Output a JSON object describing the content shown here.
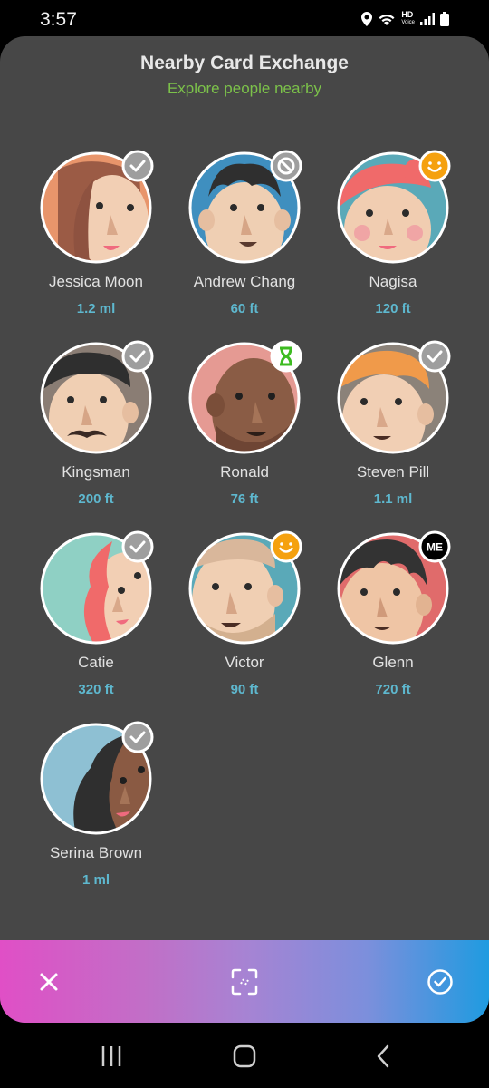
{
  "status_bar": {
    "time": "3:57",
    "hd_label": "HD",
    "voice_label": "Voice"
  },
  "header": {
    "title": "Nearby Card Exchange",
    "subtitle": "Explore people nearby"
  },
  "people": [
    {
      "name": "Jessica Moon",
      "distance": "1.2 ml",
      "badge": "check-icon"
    },
    {
      "name": "Andrew Chang",
      "distance": "60 ft",
      "badge": "blocked-icon"
    },
    {
      "name": "Nagisa",
      "distance": "120 ft",
      "badge": "smile-icon"
    },
    {
      "name": "Kingsman",
      "distance": "200 ft",
      "badge": "check-icon"
    },
    {
      "name": "Ronald",
      "distance": "76 ft",
      "badge": "hourglass-icon"
    },
    {
      "name": "Steven Pill",
      "distance": "1.1 ml",
      "badge": "check-icon"
    },
    {
      "name": "Catie",
      "distance": "320 ft",
      "badge": "check-icon"
    },
    {
      "name": "Victor",
      "distance": "90 ft",
      "badge": "smile-icon"
    },
    {
      "name": "Glenn",
      "distance": "720 ft",
      "badge": "me-badge",
      "badge_text": "ME"
    },
    {
      "name": "Serina Brown",
      "distance": "1 ml",
      "badge": "check-icon"
    }
  ],
  "action_bar": {
    "close_icon": "close-icon",
    "scan_icon": "scan-icon",
    "confirm_icon": "check-circle-icon"
  },
  "colors": {
    "background": "#474747",
    "subtitle": "#7cc24a",
    "distance": "#5eb8cf",
    "badge_gray": "#9e9e9e",
    "badge_orange": "#f5a10f",
    "badge_green": "#3dbb21"
  }
}
